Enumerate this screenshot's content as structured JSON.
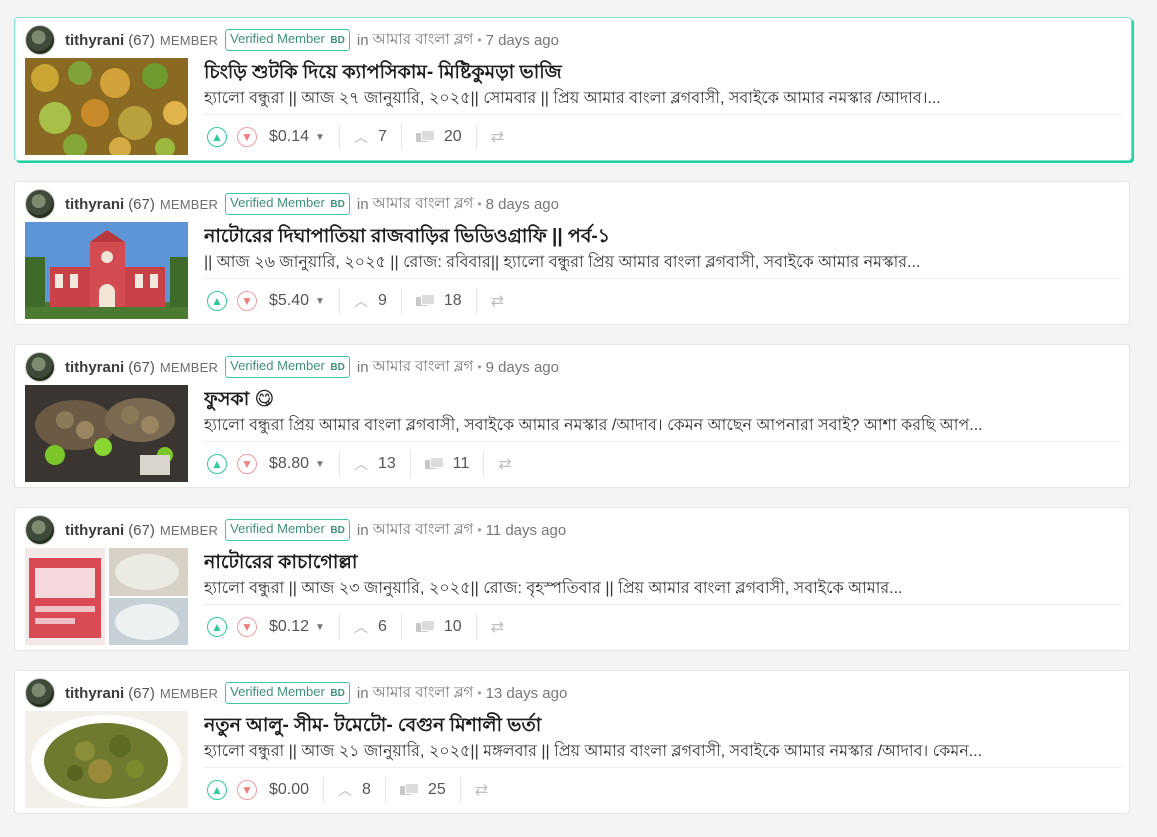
{
  "posts": [
    {
      "author": "tithyrani",
      "reputation": "(67)",
      "role": "MEMBER",
      "badge": "Verified Member",
      "badge_suffix": "BD",
      "in_label": "in",
      "community": "আমার বাংলা ব্লগ",
      "time": "7 days ago",
      "title": "চিংড়ি শুটকি দিয়ে ক্যাপসিকাম- মিষ্টিকুমড়া ভাজি",
      "summary": "হ্যালো বন্ধুরা || আজ ২৭ জানুয়ারি, ২০২৫|| সোমবার || প্রিয় আমার বাংলা ব্লগবাসী, সবাইকে আমার নমস্কার /আদাব।...",
      "payout": "$0.14",
      "votes": "7",
      "comments": "20"
    },
    {
      "author": "tithyrani",
      "reputation": "(67)",
      "role": "MEMBER",
      "badge": "Verified Member",
      "badge_suffix": "BD",
      "in_label": "in",
      "community": "আমার বাংলা ব্লগ",
      "time": "8 days ago",
      "title": "নাটোরের দিঘাপাতিয়া রাজবাড়ির ভিডিওগ্রাফি || পর্ব-১",
      "summary": "|| আজ ২৬ জানুয়ারি, ২০২৫ || রোজ: রবিবার|| হ্যালো বন্ধুরা প্রিয় আমার বাংলা ব্লগবাসী, সবাইকে আমার নমস্কার...",
      "payout": "$5.40",
      "votes": "9",
      "comments": "18"
    },
    {
      "author": "tithyrani",
      "reputation": "(67)",
      "role": "MEMBER",
      "badge": "Verified Member",
      "badge_suffix": "BD",
      "in_label": "in",
      "community": "আমার বাংলা ব্লগ",
      "time": "9 days ago",
      "title": "ফুসকা 😋",
      "summary": "হ্যালো বন্ধুরা প্রিয় আমার বাংলা ব্লগবাসী, সবাইকে আমার নমস্কার /আদাব। কেমন আছেন আপনারা সবাই? আশা করছি আপ...",
      "payout": "$8.80",
      "votes": "13",
      "comments": "11"
    },
    {
      "author": "tithyrani",
      "reputation": "(67)",
      "role": "MEMBER",
      "badge": "Verified Member",
      "badge_suffix": "BD",
      "in_label": "in",
      "community": "আমার বাংলা ব্লগ",
      "time": "11 days ago",
      "title": "নাটোরের কাচাগোল্লা",
      "summary": "হ্যালো বন্ধুরা || আজ ২৩ জানুয়ারি, ২০২৫|| রোজ: বৃহস্পতিবার || প্রিয় আমার বাংলা ব্লগবাসী, সবাইকে আমার...",
      "payout": "$0.12",
      "votes": "6",
      "comments": "10"
    },
    {
      "author": "tithyrani",
      "reputation": "(67)",
      "role": "MEMBER",
      "badge": "Verified Member",
      "badge_suffix": "BD",
      "in_label": "in",
      "community": "আমার বাংলা ব্লগ",
      "time": "13 days ago",
      "title": "নতুন আলু- সীম- টমেটো- বেগুন মিশালী ভর্তা",
      "summary": "হ্যালো বন্ধুরা || আজ ২১ জানুয়ারি, ২০২৫|| মঙ্গলবার || প্রিয় আমার বাংলা ব্লগবাসী, সবাইকে আমার নমস্কার /আদাব। কেমন...",
      "payout": "$0.00",
      "votes": "8",
      "comments": "25"
    }
  ],
  "icons": {
    "upvote": "upvote-icon",
    "downvote": "downvote-icon",
    "payout_menu": "chevron-down-icon",
    "votes": "chevron-up-icon",
    "comments": "comments-icon",
    "reblog": "reblog-icon"
  },
  "colors": {
    "accent": "#23d3a5",
    "upvote": "#2ecc9c",
    "downvote": "#f29d9d"
  }
}
